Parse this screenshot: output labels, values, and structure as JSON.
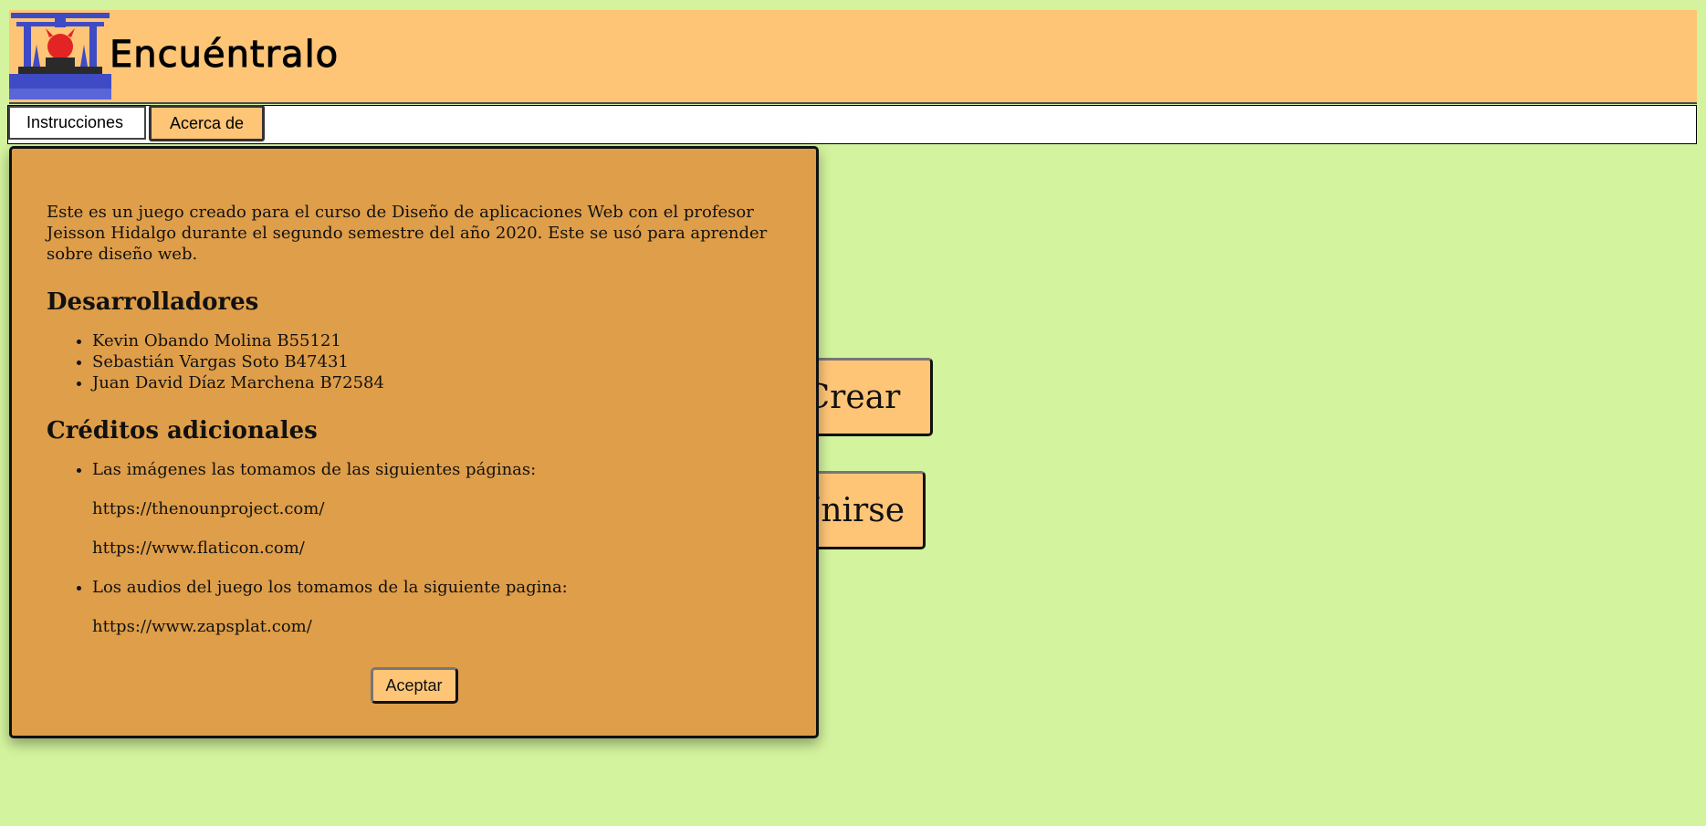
{
  "header": {
    "app_title": "Encuéntralo",
    "logo_icon": "torii-gate-oni-logo-icon"
  },
  "nav": {
    "instructions_label": "Instrucciones",
    "about_label": "Acerca de"
  },
  "main": {
    "create_label": "Crear",
    "join_label": "Unirse"
  },
  "modal": {
    "intro": "Este es un juego creado para el curso de Diseño de aplicaciones Web con el profesor Jeisson Hidalgo durante el segundo semestre del año 2020. Este se usó para aprender sobre diseño web.",
    "developers_heading": "Desarrolladores",
    "developers": [
      "Kevin Obando Molina B55121",
      "Sebastián Vargas Soto B47431",
      "Juan David Díaz Marchena B72584"
    ],
    "credits_heading": "Créditos adicionales",
    "credits": {
      "images_text": "Las imágenes las tomamos de las siguientes páginas:",
      "images_link_1": "https://thenounproject.com/",
      "images_link_2": "https://www.flaticon.com/",
      "audio_text": "Los audios del juego los tomamos de la siguiente pagina:",
      "audio_link": "https://www.zapsplat.com/"
    },
    "accept_label": "Aceptar"
  },
  "colors": {
    "background": "#d3f39e",
    "header": "#fec577",
    "modal": "#df9e49",
    "button": "#fec577"
  }
}
